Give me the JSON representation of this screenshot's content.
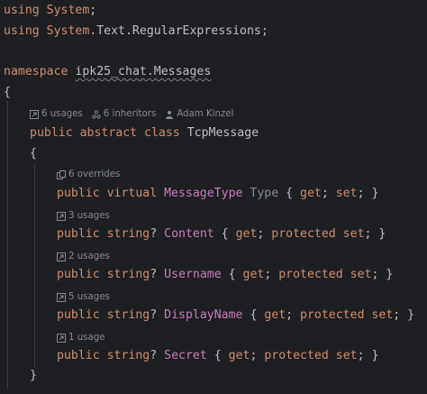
{
  "usings": [
    {
      "kw": "using",
      "name": "System",
      "rest": ""
    },
    {
      "kw": "using",
      "name": "System",
      "rest": ".Text.RegularExpressions"
    }
  ],
  "namespace": {
    "kw": "namespace",
    "name": "ipk25_chat.Messages"
  },
  "class_hints": {
    "usages": "6 usages",
    "inheritors": "6 inheritors",
    "author": "Adam Kinzel"
  },
  "class_decl": {
    "modifiers": "public abstract class",
    "name": "TcpMessage"
  },
  "members": [
    {
      "hint": "6 overrides",
      "hint_icon": "overrides-icon",
      "modifiers": "public virtual",
      "type": "MessageType",
      "nullable": "",
      "name": "Type",
      "accessors": "{ get; set; }"
    },
    {
      "hint": "3 usages",
      "hint_icon": "usages-icon",
      "modifiers": "public",
      "type": "string",
      "nullable": "?",
      "name": "Content",
      "accessors": "{ get; protected set; }"
    },
    {
      "hint": "2 usages",
      "hint_icon": "usages-icon",
      "modifiers": "public",
      "type": "string",
      "nullable": "?",
      "name": "Username",
      "accessors": "{ get; protected set; }"
    },
    {
      "hint": "5 usages",
      "hint_icon": "usages-icon",
      "modifiers": "public",
      "type": "string",
      "nullable": "?",
      "name": "DisplayName",
      "accessors": "{ get; protected set; }"
    },
    {
      "hint": "1 usage",
      "hint_icon": "usages-icon",
      "modifiers": "public",
      "type": "string",
      "nullable": "?",
      "name": "Secret",
      "accessors": "{ get; protected set; }"
    }
  ],
  "braces": {
    "open": "{",
    "close": "}"
  },
  "colors": {
    "background": "#1e1f22",
    "keyword": "#cf8e6d",
    "property": "#c77dbb",
    "text": "#bcbec4",
    "hint": "#868a91"
  }
}
